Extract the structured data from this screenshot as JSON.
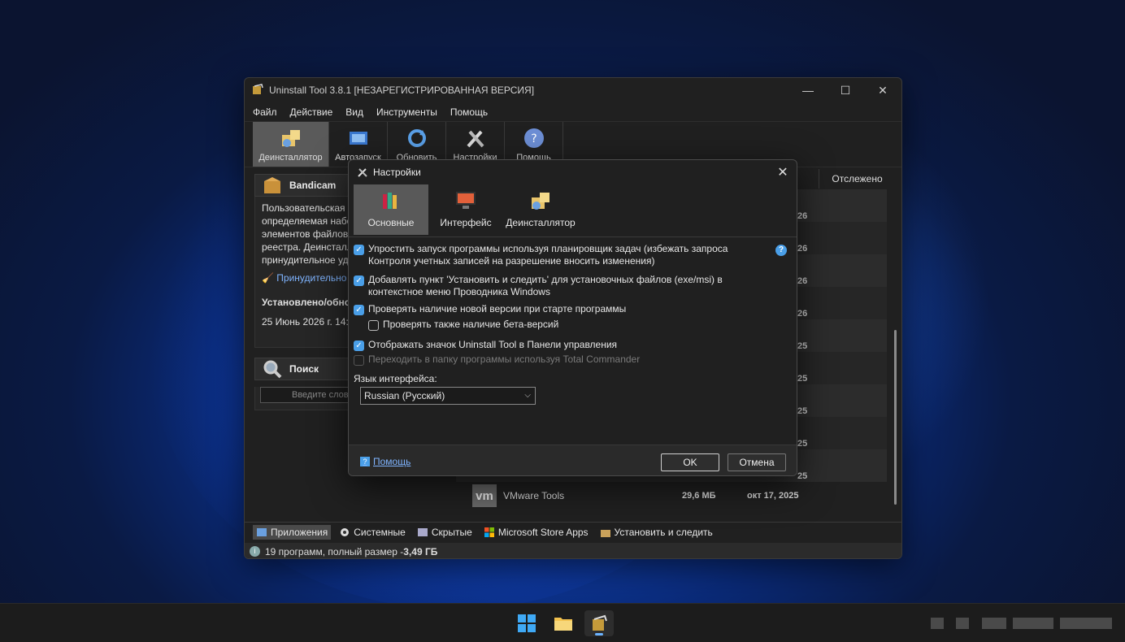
{
  "window": {
    "title": "Uninstall Tool 3.8.1 [НЕЗАРЕГИСТРИРОВАННАЯ ВЕРСИЯ]",
    "minimize": "—",
    "maximize": "☐",
    "close": "✕"
  },
  "menu": [
    "Файл",
    "Действие",
    "Вид",
    "Инструменты",
    "Помощь"
  ],
  "toolbar": {
    "buttons": [
      {
        "label": "Деинсталлятор",
        "icon": "uninstaller-icon"
      },
      {
        "label": "Автозапуск",
        "icon": "autorun-icon"
      },
      {
        "label": "Обновить",
        "icon": "refresh-icon"
      },
      {
        "label": "Настройки",
        "icon": "tools-icon"
      },
      {
        "label": "Помощь",
        "icon": "help-icon"
      }
    ]
  },
  "left_panel": {
    "app_name": "Bandicam",
    "description": "Пользовательская з\nопределяемая набо\nэлементов файлово\nреестра. Деинсталл\nпринудительное уда",
    "force_link": "Принудительно",
    "installed_label": "Установлено/обнов",
    "installed_value": "25 Июнь 2026 г. 14:4",
    "search_title": "Поиск",
    "search_placeholder": "Введите слов"
  },
  "list": {
    "tracked_header": "Отслежено",
    "partial_dates": [
      "26",
      "26",
      "26",
      "26",
      "25",
      "25",
      "25",
      "25",
      "25"
    ],
    "vm_row": {
      "name": "VMware Tools",
      "size": "29,6 МБ",
      "date": "окт 17, 2025",
      "logo": "vm"
    }
  },
  "bottom_tabs": [
    "Приложения",
    "Системные",
    "Скрытые",
    "Microsoft Store Apps",
    "Установить и следить"
  ],
  "status": {
    "text": "19 программ, полный размер - ",
    "size": "3,49 ГБ"
  },
  "dialog": {
    "title": "Настройки",
    "close": "✕",
    "tabs": [
      "Основные",
      "Интерфейс",
      "Деинсталлятор"
    ],
    "options": [
      {
        "text": "Упростить запуск программы используя планировщик задач (избежать запроса\nКонтроля учетных записей на разрешение вносить изменения)",
        "checked": true
      },
      {
        "text": "Добавлять пункт 'Установить и следить' для установочных файлов (exe/msi) в\nконтекстное меню Проводника Windows",
        "checked": true
      },
      {
        "text": "Проверять наличие новой версии при старте программы",
        "checked": true
      },
      {
        "text": "Проверять также наличие бета-версий",
        "checked": false
      },
      {
        "text": "Отображать значок Uninstall Tool в Панели управления",
        "checked": true
      },
      {
        "text": "Переходить в папку программы используя Total Commander",
        "checked": false,
        "disabled": true
      }
    ],
    "language_label": "Язык интерфейса:",
    "language_value": "Russian (Русский)",
    "help_link": "Помощь",
    "ok": "OK",
    "cancel": "Отмена"
  },
  "colors": {
    "accent": "#4a9fe8",
    "link": "#7fb4ff",
    "window_bg": "#202020"
  }
}
